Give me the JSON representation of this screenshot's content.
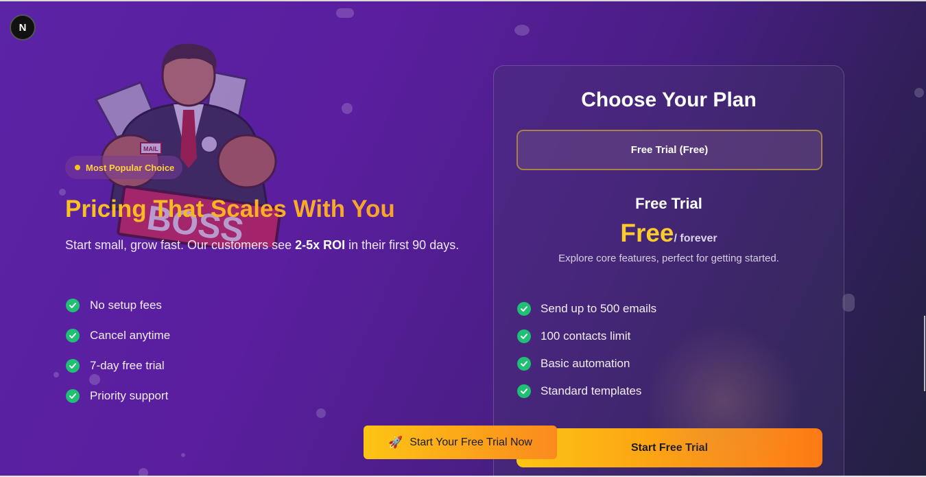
{
  "app": {
    "badge_letter": "N"
  },
  "hero": {
    "badge": "Most Popular Choice",
    "title": "Pricing That Scales With You",
    "subtitle_before": "Start small, grow fast. Our customers see ",
    "subtitle_bold": "2-5x ROI",
    "subtitle_after": " in their first 90 days.",
    "features": [
      "No setup fees",
      "Cancel anytime",
      "7-day free trial",
      "Priority support"
    ],
    "cta_label": "Start Your Free Trial Now",
    "cta_icon": "rocket-icon"
  },
  "mascot": {
    "sign_text": "BOSS",
    "envelope_text": "MAIL"
  },
  "plan_card": {
    "title": "Choose Your Plan",
    "selected_plan": "Free Trial (Free)",
    "plan_name": "Free Trial",
    "price": "Free",
    "period": "/ forever",
    "description": "Explore core features, perfect for getting started.",
    "features": [
      "Send up to 500 emails",
      "100 contacts limit",
      "Basic automation",
      "Standard templates"
    ],
    "cta_label": "Start Free Trial"
  },
  "colors": {
    "accent_yellow": "#fbcb2b",
    "accent_orange": "#fd7a15",
    "check_green": "#1fbf74",
    "background_purple": "#5a1e9e"
  }
}
